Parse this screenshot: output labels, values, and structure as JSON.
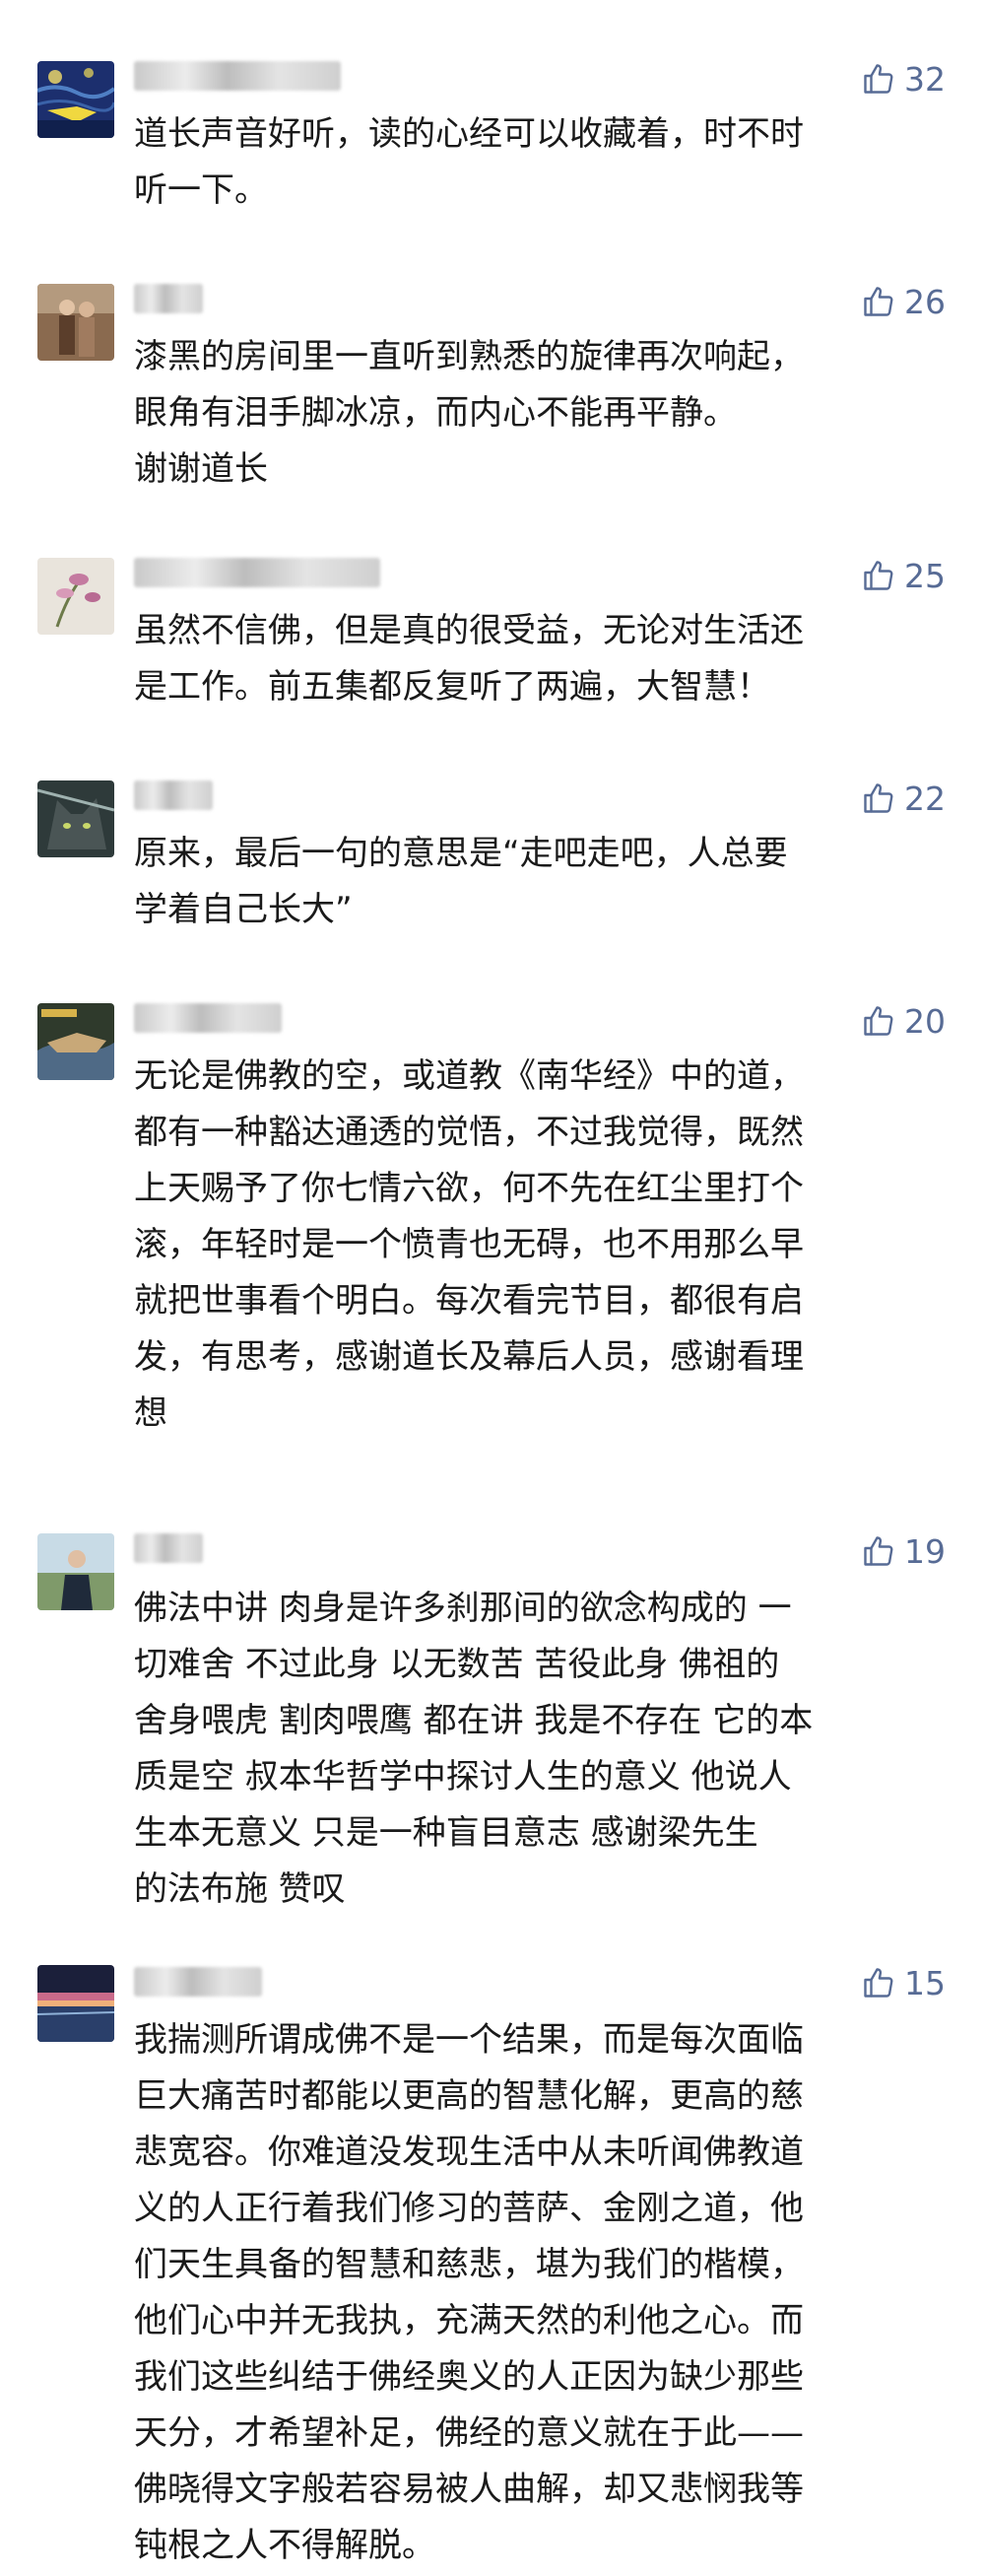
{
  "colors": {
    "like": "#576b95",
    "text": "#1a1a1a",
    "background": "#ffffff"
  },
  "comments": [
    {
      "likes": "32",
      "avatar_icon": "starry-night-avatar-icon",
      "text": "道长声音好听，读的心经可以收藏着，时不时\n听一下。"
    },
    {
      "likes": "26",
      "avatar_icon": "couple-photo-avatar-icon",
      "text": "漆黑的房间里一直听到熟悉的旋律再次响起，\n眼角有泪手脚冰凉，而内心不能再平静。\n谢谢道长"
    },
    {
      "likes": "25",
      "avatar_icon": "flower-avatar-icon",
      "text": "虽然不信佛，但是真的很受益，无论对生活还\n是工作。前五集都反复听了两遍，大智慧！"
    },
    {
      "likes": "22",
      "avatar_icon": "cat-avatar-icon",
      "text": "原来，最后一句的意思是“走吧走吧，人总要\n学着自己长大”"
    },
    {
      "likes": "20",
      "avatar_icon": "book-cover-avatar-icon",
      "text": "无论是佛教的空，或道教《南华经》中的道，\n都有一种豁达通透的觉悟，不过我觉得，既然\n上天赐予了你七情六欲，何不先在红尘里打个\n滚，年轻时是一个愤青也无碍，也不用那么早\n就把世事看个明白。每次看完节目，都很有启\n发，有思考，感谢道长及幕后人员，感谢看理\n想"
    },
    {
      "likes": "19",
      "avatar_icon": "person-outdoor-avatar-icon",
      "text": "佛法中讲 肉身是许多刹那间的欲念构成的 一\n切难舍 不过此身 以无数苦 苦役此身  佛祖的\n舍身喂虎 割肉喂鹰 都在讲 我是不存在 它的本\n质是空  叔本华哲学中探讨人生的意义 他说人\n生本无意义 只是一种盲目意志     感谢梁先生\n的法布施  赞叹"
    },
    {
      "likes": "15",
      "avatar_icon": "sunset-avatar-icon",
      "text": "我揣测所谓成佛不是一个结果，而是每次面临\n巨大痛苦时都能以更高的智慧化解，更高的慈\n悲宽容。你难道没发现生活中从未听闻佛教道\n义的人正行着我们修习的菩萨、金刚之道，他\n们天生具备的智慧和慈悲，堪为我们的楷模，\n他们心中并无我执，充满天然的利他之心。而\n我们这些纠结于佛经奥义的人正因为缺少那些\n天分，才希望补足，佛经的意义就在于此——\n佛晓得文字般若容易被人曲解，却又悲悯我等\n钝根之人不得解脱。"
    }
  ]
}
